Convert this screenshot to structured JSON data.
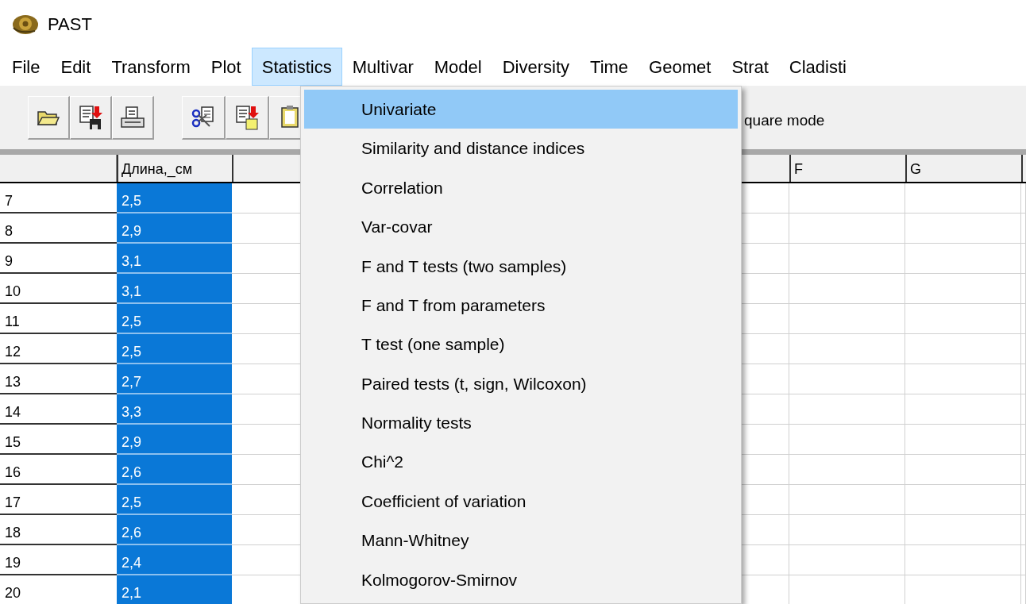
{
  "window": {
    "title": "PAST"
  },
  "menu_bar": [
    {
      "label": "File",
      "selected": false
    },
    {
      "label": "Edit",
      "selected": false
    },
    {
      "label": "Transform",
      "selected": false
    },
    {
      "label": "Plot",
      "selected": false
    },
    {
      "label": "Statistics",
      "selected": true
    },
    {
      "label": "Multivar",
      "selected": false
    },
    {
      "label": "Model",
      "selected": false
    },
    {
      "label": "Diversity",
      "selected": false
    },
    {
      "label": "Time",
      "selected": false
    },
    {
      "label": "Geomet",
      "selected": false
    },
    {
      "label": "Strat",
      "selected": false
    },
    {
      "label": "Cladisti",
      "selected": false
    }
  ],
  "toolbar": {
    "partial_label": "quare mode"
  },
  "dropdown": [
    {
      "label": "Univariate",
      "selected": true
    },
    {
      "label": "Similarity and distance indices",
      "selected": false
    },
    {
      "label": "Correlation",
      "selected": false
    },
    {
      "label": "Var-covar",
      "selected": false
    },
    {
      "label": "F and T tests (two samples)",
      "selected": false
    },
    {
      "label": "F and T from parameters",
      "selected": false
    },
    {
      "label": "T test (one sample)",
      "selected": false
    },
    {
      "label": "Paired tests (t, sign, Wilcoxon)",
      "selected": false
    },
    {
      "label": "Normality tests",
      "selected": false
    },
    {
      "label": "Chi^2",
      "selected": false
    },
    {
      "label": "Coefficient of variation",
      "selected": false
    },
    {
      "label": "Mann-Whitney",
      "selected": false
    },
    {
      "label": "Kolmogorov-Smirnov",
      "selected": false
    }
  ],
  "grid": {
    "columns": [
      {
        "label": "Длина,_см"
      },
      {
        "label": "F"
      },
      {
        "label": "G"
      }
    ],
    "rows": [
      {
        "row": "7",
        "value": "2,5",
        "selected": true
      },
      {
        "row": "8",
        "value": "2,9",
        "selected": true
      },
      {
        "row": "9",
        "value": "3,1",
        "selected": true
      },
      {
        "row": "10",
        "value": "3,1",
        "selected": true
      },
      {
        "row": "11",
        "value": "2,5",
        "selected": true
      },
      {
        "row": "12",
        "value": "2,5",
        "selected": true
      },
      {
        "row": "13",
        "value": "2,7",
        "selected": true
      },
      {
        "row": "14",
        "value": "3,3",
        "selected": true
      },
      {
        "row": "15",
        "value": "2,9",
        "selected": true
      },
      {
        "row": "16",
        "value": "2,6",
        "selected": true
      },
      {
        "row": "17",
        "value": "2,5",
        "selected": true
      },
      {
        "row": "18",
        "value": "2,6",
        "selected": true
      },
      {
        "row": "19",
        "value": "2,4",
        "selected": true
      },
      {
        "row": "20",
        "value": "2,1",
        "selected": true
      }
    ]
  }
}
